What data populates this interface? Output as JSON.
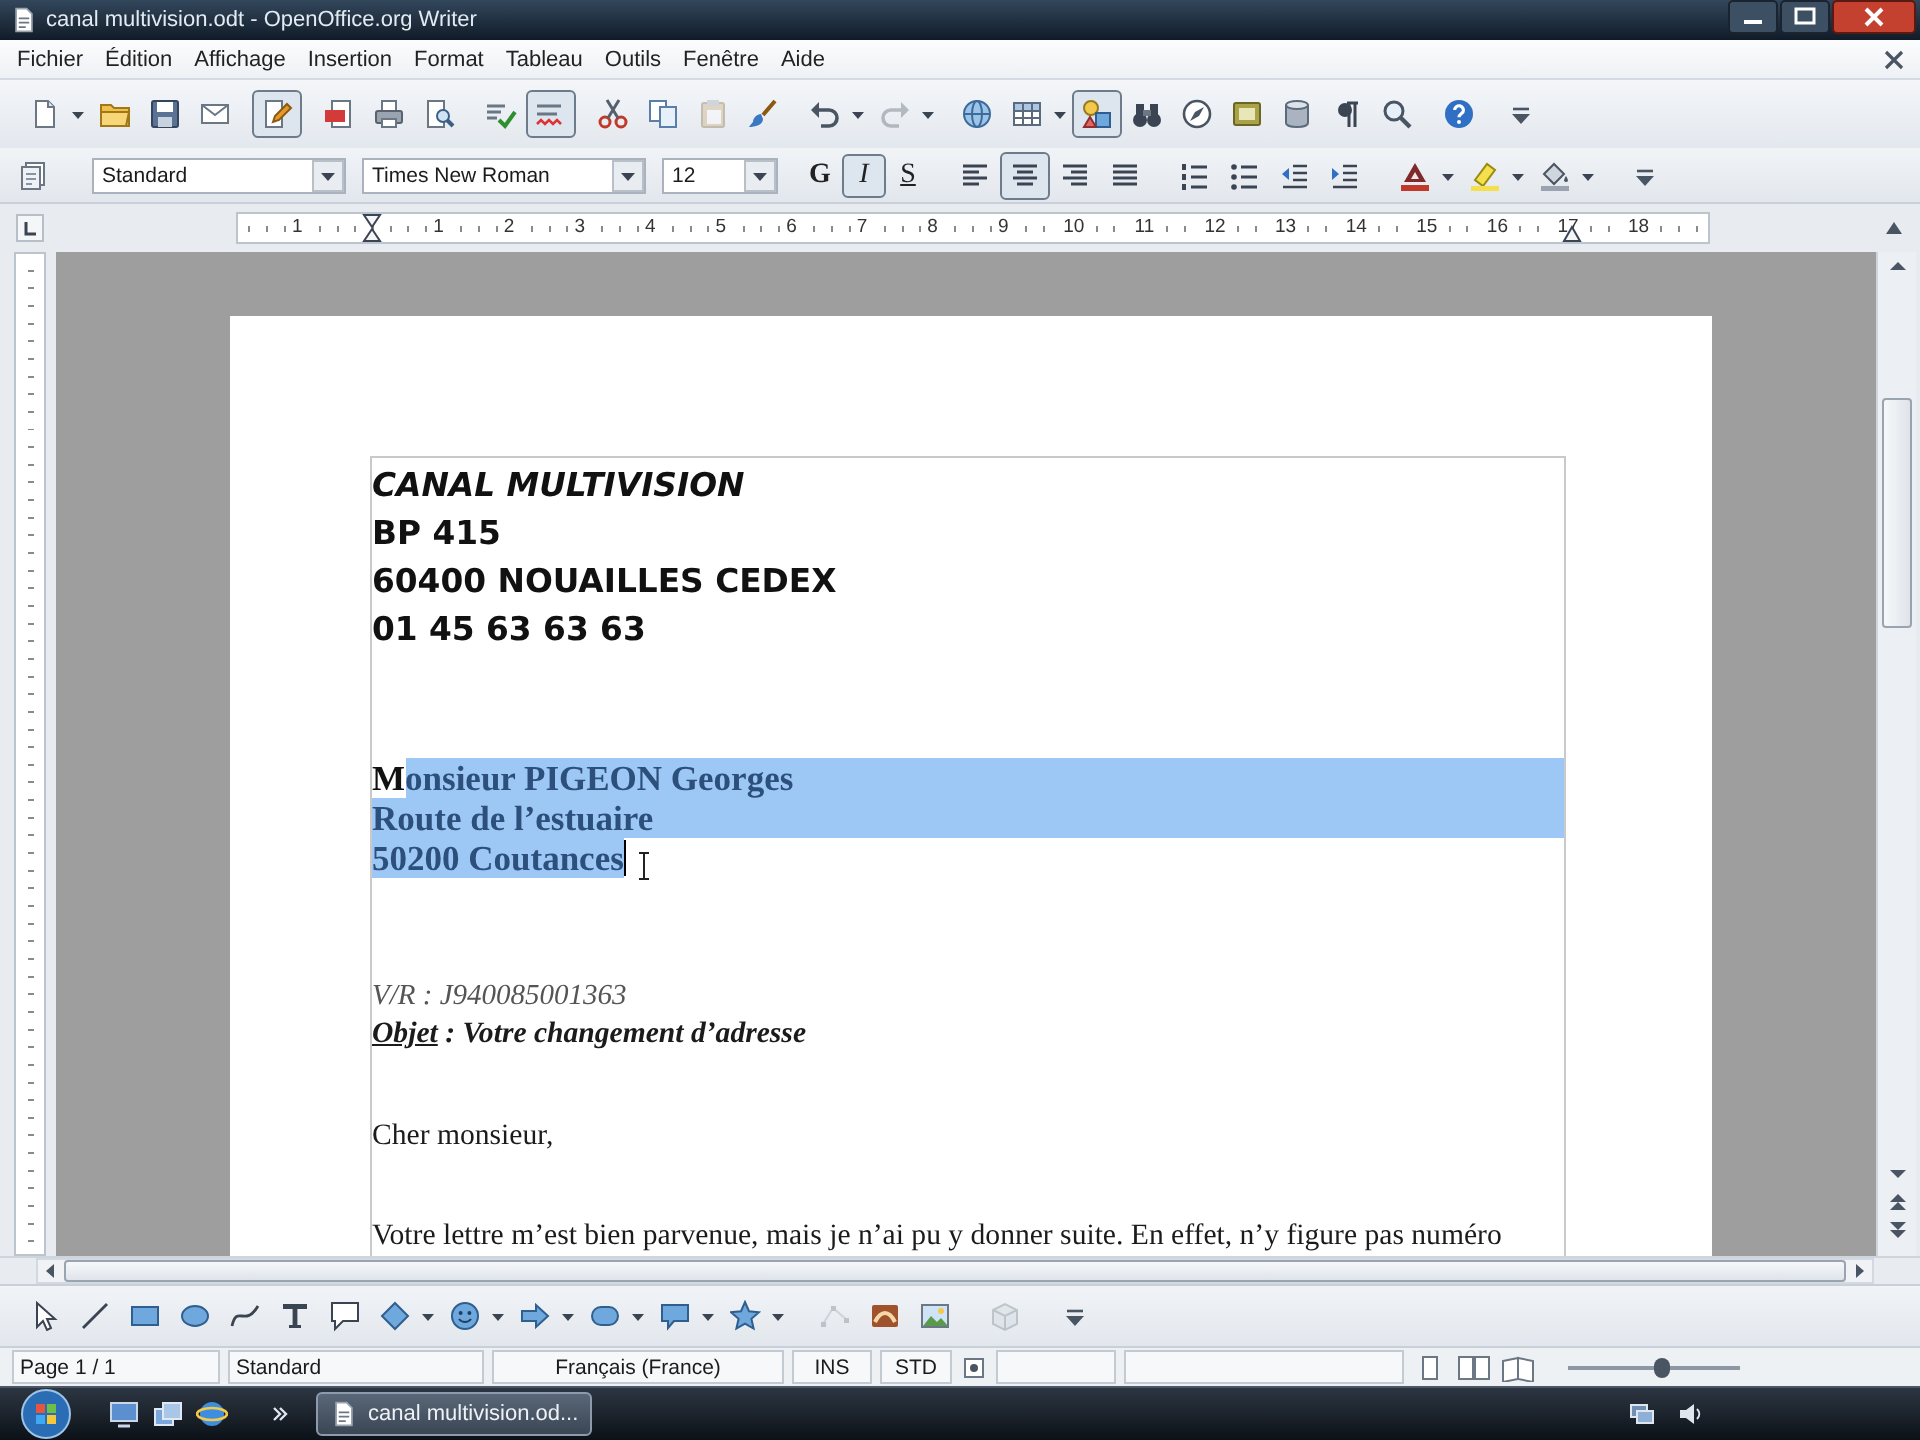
{
  "window": {
    "title": "canal multivision.odt - OpenOffice.org Writer"
  },
  "menu_bar": {
    "items": [
      "Fichier",
      "Édition",
      "Affichage",
      "Insertion",
      "Format",
      "Tableau",
      "Outils",
      "Fenêtre",
      "Aide"
    ]
  },
  "standard_toolbar": {
    "groups": [
      [
        {
          "kind": "new",
          "dropdown": true,
          "selected": false,
          "disabled": false
        },
        {
          "kind": "open",
          "dropdown": false,
          "selected": false,
          "disabled": false
        },
        {
          "kind": "save",
          "dropdown": false,
          "selected": false,
          "disabled": false
        },
        {
          "kind": "email",
          "dropdown": false,
          "selected": false,
          "disabled": false
        }
      ],
      [
        {
          "kind": "edit",
          "dropdown": false,
          "selected": true,
          "disabled": false
        }
      ],
      [
        {
          "kind": "pdf",
          "dropdown": false,
          "selected": false,
          "disabled": false
        },
        {
          "kind": "print",
          "dropdown": false,
          "selected": false,
          "disabled": false
        },
        {
          "kind": "preview",
          "dropdown": false,
          "selected": false,
          "disabled": false
        }
      ],
      [
        {
          "kind": "spell",
          "dropdown": false,
          "selected": false,
          "disabled": false
        },
        {
          "kind": "autospell",
          "dropdown": false,
          "selected": true,
          "disabled": false
        }
      ],
      [
        {
          "kind": "cut",
          "dropdown": false,
          "selected": false,
          "disabled": false
        },
        {
          "kind": "copy",
          "dropdown": false,
          "selected": false,
          "disabled": false
        },
        {
          "kind": "paste",
          "dropdown": false,
          "selected": false,
          "disabled": true
        },
        {
          "kind": "brush",
          "dropdown": false,
          "selected": false,
          "disabled": false
        }
      ],
      [
        {
          "kind": "undo",
          "dropdown": true,
          "selected": false,
          "disabled": false
        },
        {
          "kind": "redo",
          "dropdown": true,
          "selected": false,
          "disabled": true
        }
      ],
      [
        {
          "kind": "hyperlink",
          "dropdown": false,
          "selected": false,
          "disabled": false
        },
        {
          "kind": "table",
          "dropdown": true,
          "selected": false,
          "disabled": false
        },
        {
          "kind": "draw",
          "dropdown": false,
          "selected": true,
          "disabled": false
        },
        {
          "kind": "find",
          "dropdown": false,
          "selected": false,
          "disabled": false
        },
        {
          "kind": "navigator",
          "dropdown": false,
          "selected": false,
          "disabled": false
        },
        {
          "kind": "gallery",
          "dropdown": false,
          "selected": false,
          "disabled": false
        },
        {
          "kind": "datasource",
          "dropdown": false,
          "selected": false,
          "disabled": false
        },
        {
          "kind": "pilcrow",
          "dropdown": false,
          "selected": false,
          "disabled": false
        },
        {
          "kind": "zoom",
          "dropdown": false,
          "selected": false,
          "disabled": false
        }
      ],
      [
        {
          "kind": "help",
          "dropdown": false,
          "selected": false,
          "disabled": false
        }
      ],
      [
        {
          "kind": "overflow",
          "dropdown": false,
          "selected": false,
          "disabled": false
        }
      ]
    ]
  },
  "formatting_toolbar": {
    "styles_button": {
      "kind": "styles",
      "dropdown": false,
      "selected": false,
      "disabled": false
    },
    "paragraph_style": {
      "value": "Standard"
    },
    "font_name": {
      "value": "Times New Roman"
    },
    "font_size": {
      "value": "12"
    },
    "groups": [
      [
        {
          "kind": "bold",
          "label": "G",
          "dropdown": false,
          "selected": false,
          "disabled": false
        },
        {
          "kind": "italic",
          "label": "I",
          "dropdown": false,
          "selected": true,
          "disabled": false
        },
        {
          "kind": "underline",
          "label": "S",
          "dropdown": false,
          "selected": false,
          "disabled": false
        }
      ],
      [
        {
          "kind": "align-left",
          "dropdown": false,
          "selected": false,
          "disabled": false
        },
        {
          "kind": "align-center",
          "dropdown": false,
          "selected": true,
          "disabled": false
        },
        {
          "kind": "align-right",
          "dropdown": false,
          "selected": false,
          "disabled": false
        },
        {
          "kind": "justify",
          "dropdown": false,
          "selected": false,
          "disabled": false
        }
      ],
      [
        {
          "kind": "numbering",
          "dropdown": false,
          "selected": false,
          "disabled": false
        },
        {
          "kind": "bullets",
          "dropdown": false,
          "selected": false,
          "disabled": false
        },
        {
          "kind": "outdent",
          "dropdown": false,
          "selected": false,
          "disabled": false
        },
        {
          "kind": "indent",
          "dropdown": false,
          "selected": false,
          "disabled": false
        }
      ],
      [
        {
          "kind": "font-color",
          "dropdown": true,
          "selected": false,
          "disabled": false
        },
        {
          "kind": "highlight",
          "dropdown": true,
          "selected": false,
          "disabled": false
        },
        {
          "kind": "background",
          "dropdown": true,
          "selected": false,
          "disabled": false
        }
      ],
      [
        {
          "kind": "overflow",
          "dropdown": false,
          "selected": false,
          "disabled": false
        }
      ]
    ]
  },
  "ruler": {
    "left_labels": [
      "1"
    ],
    "labels": [
      "1",
      "2",
      "3",
      "4",
      "5",
      "6",
      "7",
      "8",
      "9",
      "10",
      "11",
      "12",
      "13",
      "14",
      "15",
      "16",
      "17",
      "18"
    ]
  },
  "document": {
    "sender": [
      {
        "kind": "company",
        "text": "CANAL MULTIVISION"
      },
      {
        "kind": "line",
        "text": "BP 415"
      },
      {
        "kind": "line",
        "text": "60400 NOUAILLES CEDEX"
      },
      {
        "kind": "line",
        "text": "01 45 63 63 63"
      }
    ],
    "recipient": [
      {
        "segments": [
          {
            "text": "M",
            "selected": false
          },
          {
            "text": "onsieur PIGEON Georges",
            "selected": true
          }
        ],
        "selected_to_end": true,
        "caret": false
      },
      {
        "segments": [
          {
            "text": "Route de l’estuaire",
            "selected": true
          }
        ],
        "selected_to_end": true,
        "caret": false
      },
      {
        "segments": [
          {
            "text": "50200 Coutances",
            "selected": true
          }
        ],
        "selected_to_end": false,
        "caret": true
      }
    ],
    "reference": "V/R : J940085001363",
    "subject": {
      "label": "Objet",
      "text": ": Votre changement d’adresse"
    },
    "greeting": "Cher monsieur,",
    "body": "Votre lettre m’est bien parvenue, mais je n’ai pu y donner suite. En effet, n’y figure pas numéro"
  },
  "drawing_toolbar": {
    "groups": [
      [
        {
          "kind": "select",
          "dropdown": false,
          "selected": false,
          "disabled": false
        },
        {
          "kind": "line",
          "dropdown": false,
          "selected": false,
          "disabled": false
        },
        {
          "kind": "rectangle",
          "dropdown": false,
          "selected": false,
          "disabled": false
        },
        {
          "kind": "ellipse",
          "dropdown": false,
          "selected": false,
          "disabled": false
        },
        {
          "kind": "curve",
          "dropdown": false,
          "selected": false,
          "disabled": false
        },
        {
          "kind": "text",
          "dropdown": false,
          "selected": false,
          "disabled": false
        },
        {
          "kind": "callout",
          "dropdown": false,
          "selected": false,
          "disabled": false
        },
        {
          "kind": "basic-shapes",
          "dropdown": true,
          "selected": false,
          "disabled": false
        },
        {
          "kind": "symbol-shapes",
          "dropdown": true,
          "selected": false,
          "disabled": false
        },
        {
          "kind": "block-arrows",
          "dropdown": true,
          "selected": false,
          "disabled": false
        },
        {
          "kind": "flowchart",
          "dropdown": true,
          "selected": false,
          "disabled": false
        },
        {
          "kind": "callouts",
          "dropdown": true,
          "selected": false,
          "disabled": false
        },
        {
          "kind": "stars",
          "dropdown": true,
          "selected": false,
          "disabled": false
        }
      ],
      [
        {
          "kind": "points",
          "dropdown": false,
          "selected": false,
          "disabled": true
        },
        {
          "kind": "fontwork",
          "dropdown": false,
          "selected": false,
          "disabled": false
        },
        {
          "kind": "from-file",
          "dropdown": false,
          "selected": false,
          "disabled": false
        }
      ],
      [
        {
          "kind": "extrusion",
          "dropdown": false,
          "selected": false,
          "disabled": true
        }
      ],
      [
        {
          "kind": "overflow",
          "dropdown": false,
          "selected": false,
          "disabled": false
        }
      ]
    ]
  },
  "status_bar": {
    "fields": [
      {
        "kind": "page",
        "text": "Page 1 / 1"
      },
      {
        "kind": "page-style",
        "text": "Standard"
      },
      {
        "kind": "language",
        "text": "Français (France)"
      },
      {
        "kind": "insert-mode",
        "text": "INS"
      },
      {
        "kind": "selection-mode",
        "text": "STD"
      }
    ],
    "zoom_slider": {
      "level": 0.55
    }
  },
  "taskbar": {
    "tasks": [
      {
        "label": "canal multivision.od...",
        "selected": true
      }
    ]
  }
}
